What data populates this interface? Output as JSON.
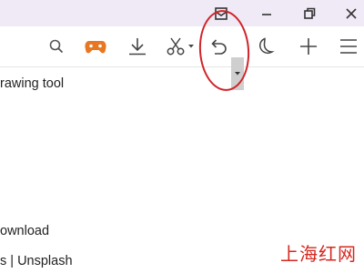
{
  "toolbar": {
    "icons": [
      "search-icon",
      "game-controller-icon",
      "download-icon",
      "scissors-icon",
      "undo-icon",
      "night-mode-icon",
      "new-tab-icon",
      "menu-icon"
    ],
    "accent": "#e87722"
  },
  "titlebar": {
    "controls": [
      "feedback-icon",
      "minimize-icon",
      "restore-icon",
      "close-icon"
    ]
  },
  "content": {
    "line1": "rawing tool",
    "line2": "ownload",
    "line3": "s | Unsplash"
  },
  "annotation": {
    "color": "#d0232a"
  },
  "watermark": {
    "text": "上海红网"
  }
}
